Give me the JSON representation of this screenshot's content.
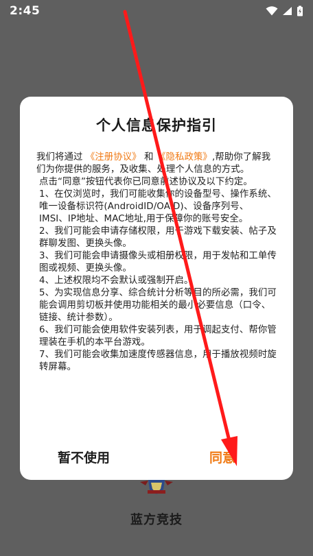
{
  "status_bar": {
    "time": "2:45"
  },
  "app": {
    "name": "蓝方竞技"
  },
  "dialog": {
    "title": "个人信息保护指引",
    "intro_prefix": "我们将通过",
    "link_register": "《注册协议》",
    "conjunction": "和",
    "link_privacy": "《隐私政策》",
    "intro_suffix": ",帮助你了解我们为你提供的服务，及收集、处理个人信息的方式。",
    "consent_note": "点击“同意”按钮代表你已同意前述协议及以下约定。",
    "items": [
      "1、在仅浏览时，我们可能收集你的设备型号、操作系统、唯一设备标识符(AndroidID/OAID)、设备序列号、IMSI、IP地址、MAC地址,用于保障你的账号安全。",
      "2、我们可能会申请存储权限，用于游戏下载安装、帖子及群聊发图、更换头像。",
      "3、我们可能会申请摄像头或相册权限，用于发帖和工单传图或视频、更换头像。",
      "4、上述权限均不会默认或强制开启。",
      "5、为实现信息分享、综合统计分析等目的所必需，我们可能会调用剪切板并使用功能相关的最小必要信息（口令、链接、统计参数）。",
      "6、我们可能会使用软件安装列表，用于调起支付、帮你管理装在手机的本平台游戏。",
      "7、我们可能会收集加速度传感器信息，用于播放视频时旋转屏幕。"
    ],
    "decline_label": "暂不使用",
    "agree_label": "同意"
  },
  "colors": {
    "accent": "#f07a14",
    "annotation_arrow": "#ff1a1a",
    "scrim": "#5f5f5f"
  }
}
